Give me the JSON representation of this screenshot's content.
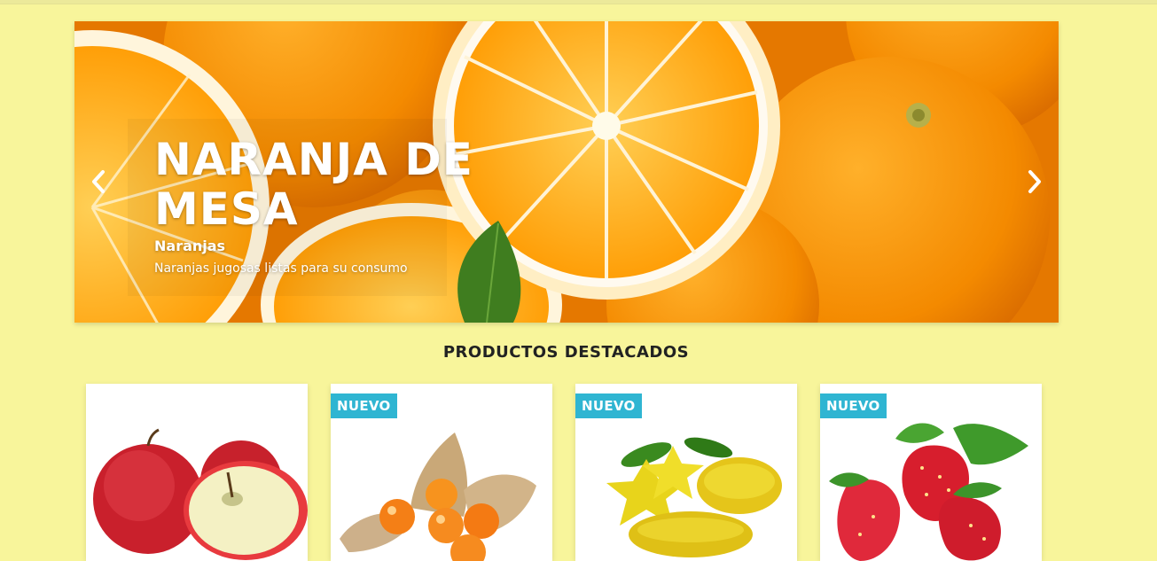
{
  "slider": {
    "title": "NARANJA DE MESA",
    "subtitle": "Naranjas",
    "description": "Naranjas jugosas listas para su consumo",
    "prev_icon": "chevron-left-icon",
    "next_icon": "chevron-right-icon"
  },
  "featured": {
    "title": "PRODUCTOS DESTACADOS",
    "products": [
      {
        "image": "apples",
        "badge": ""
      },
      {
        "image": "physalis",
        "badge": "NUEVO"
      },
      {
        "image": "starfruit",
        "badge": "NUEVO"
      },
      {
        "image": "strawberries",
        "badge": "NUEVO"
      }
    ]
  },
  "colors": {
    "page_background": "#f8f59b",
    "badge_background": "#2fb5d2"
  }
}
